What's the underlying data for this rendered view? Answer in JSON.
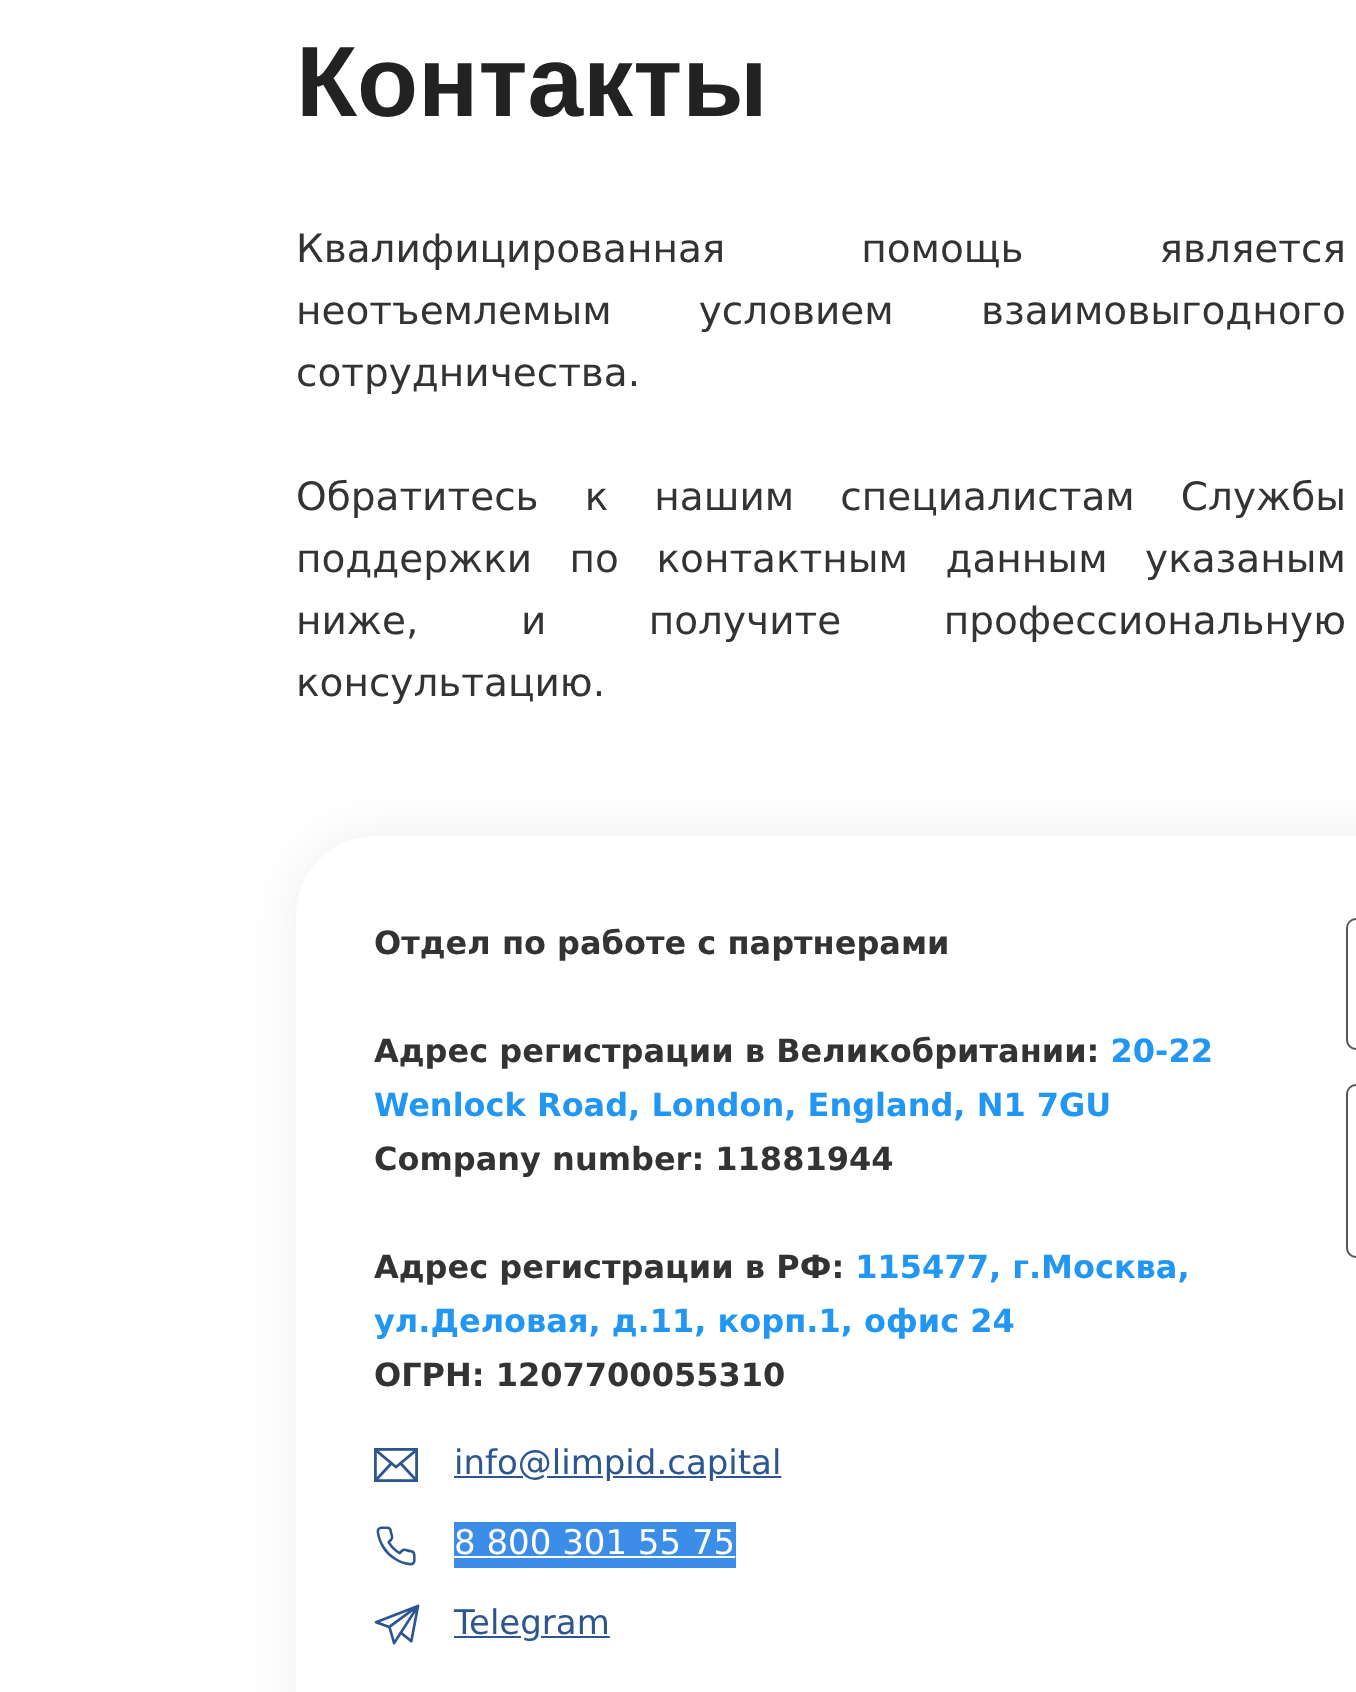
{
  "heading": "Контакты",
  "intro": [
    "Квалифицированная помощь является неотъемлемым условием взаимовыгодного сотрудничества.",
    "Обратитесь к нашим специалистам Службы поддержки по контактным данным указаным ниже, и получите профессиональную консультацию."
  ],
  "card": {
    "department": "Отдел по работе с партнерами",
    "entities": [
      {
        "address_label": "Адрес регистрации в Великобритании:",
        "address": "20-22 Wenlock Road, London, England, N1 7GU",
        "number_label": "Company number:",
        "number": "11881944"
      },
      {
        "address_label": "Адрес регистрации в РФ:",
        "address": "115477, г.Москва, ул.Деловая, д.11, корп.1, офис 24",
        "number_label": "ОГРН:",
        "number": "1207700055310"
      }
    ],
    "contacts": [
      {
        "kind": "email",
        "text": "info@limpid.capital",
        "highlighted": false
      },
      {
        "kind": "phone",
        "text": "8 800 301 55 75",
        "highlighted": true
      },
      {
        "kind": "telegram",
        "text": "Telegram",
        "highlighted": false
      }
    ]
  }
}
